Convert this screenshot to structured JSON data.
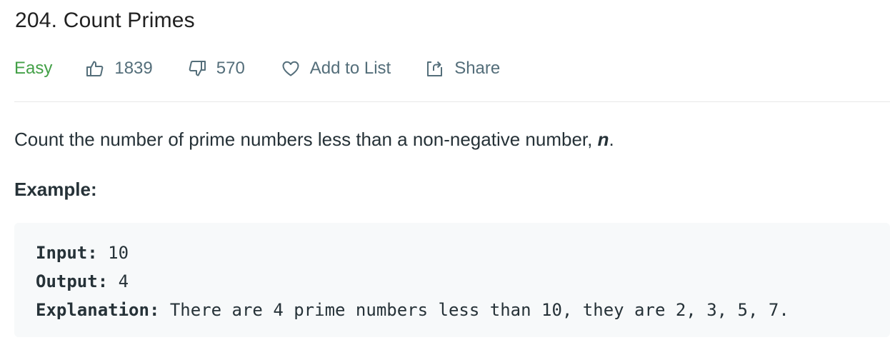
{
  "problem": {
    "title": "204. Count Primes",
    "difficulty": "Easy",
    "likes": "1839",
    "dislikes": "570",
    "add_to_list_label": "Add to List",
    "share_label": "Share",
    "description_text": "Count the number of prime numbers less than a non-negative number, ",
    "description_var": "n",
    "description_end": ".",
    "example_heading": "Example:",
    "example": {
      "input_label": "Input:",
      "input_value": " 10",
      "output_label": "Output:",
      "output_value": " 4",
      "explanation_label": "Explanation:",
      "explanation_value": " There are 4 prime numbers less than 10, they are 2, 3, 5, 7."
    }
  },
  "colors": {
    "easy": "#43a047",
    "meta_text": "#546e7a",
    "code_bg": "#f7f9fa",
    "divider": "#e8e8e8"
  },
  "icons": {
    "like": "thumbs-up-icon",
    "dislike": "thumbs-down-icon",
    "add_to_list": "heart-icon",
    "share": "share-icon"
  }
}
